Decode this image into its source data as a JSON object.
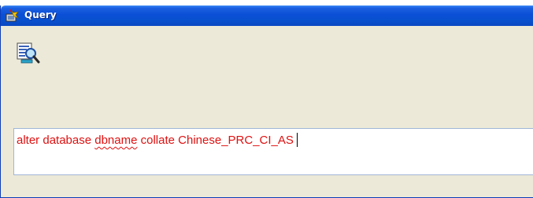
{
  "window": {
    "title": "Query",
    "title_icon": "tool-icon",
    "main_icon": "query-magnifier-icon"
  },
  "editor": {
    "text_before": "alter database ",
    "text_underlined": "dbname",
    "text_after": " collate Chinese_PRC_CI_AS",
    "text_color": "#e01010"
  },
  "colors": {
    "titlebar": "#0a4fd6",
    "window_bg": "#ece9d8"
  }
}
